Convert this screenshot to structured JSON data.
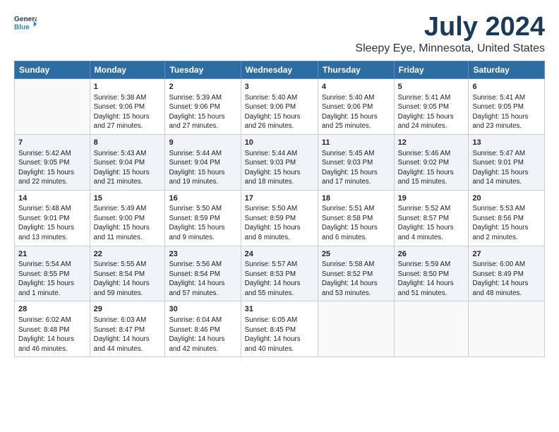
{
  "logo": {
    "line1": "General",
    "line2": "Blue"
  },
  "title": "July 2024",
  "subtitle": "Sleepy Eye, Minnesota, United States",
  "days_of_week": [
    "Sunday",
    "Monday",
    "Tuesday",
    "Wednesday",
    "Thursday",
    "Friday",
    "Saturday"
  ],
  "weeks": [
    [
      {
        "day": "",
        "empty": true
      },
      {
        "day": "1",
        "sunrise": "5:38 AM",
        "sunset": "9:06 PM",
        "daylight": "15 hours and 27 minutes."
      },
      {
        "day": "2",
        "sunrise": "5:39 AM",
        "sunset": "9:06 PM",
        "daylight": "15 hours and 27 minutes."
      },
      {
        "day": "3",
        "sunrise": "5:40 AM",
        "sunset": "9:06 PM",
        "daylight": "15 hours and 26 minutes."
      },
      {
        "day": "4",
        "sunrise": "5:40 AM",
        "sunset": "9:06 PM",
        "daylight": "15 hours and 25 minutes."
      },
      {
        "day": "5",
        "sunrise": "5:41 AM",
        "sunset": "9:05 PM",
        "daylight": "15 hours and 24 minutes."
      },
      {
        "day": "6",
        "sunrise": "5:41 AM",
        "sunset": "9:05 PM",
        "daylight": "15 hours and 23 minutes."
      }
    ],
    [
      {
        "day": "7",
        "sunrise": "5:42 AM",
        "sunset": "9:05 PM",
        "daylight": "15 hours and 22 minutes."
      },
      {
        "day": "8",
        "sunrise": "5:43 AM",
        "sunset": "9:04 PM",
        "daylight": "15 hours and 21 minutes."
      },
      {
        "day": "9",
        "sunrise": "5:44 AM",
        "sunset": "9:04 PM",
        "daylight": "15 hours and 19 minutes."
      },
      {
        "day": "10",
        "sunrise": "5:44 AM",
        "sunset": "9:03 PM",
        "daylight": "15 hours and 18 minutes."
      },
      {
        "day": "11",
        "sunrise": "5:45 AM",
        "sunset": "9:03 PM",
        "daylight": "15 hours and 17 minutes."
      },
      {
        "day": "12",
        "sunrise": "5:46 AM",
        "sunset": "9:02 PM",
        "daylight": "15 hours and 15 minutes."
      },
      {
        "day": "13",
        "sunrise": "5:47 AM",
        "sunset": "9:01 PM",
        "daylight": "15 hours and 14 minutes."
      }
    ],
    [
      {
        "day": "14",
        "sunrise": "5:48 AM",
        "sunset": "9:01 PM",
        "daylight": "15 hours and 13 minutes."
      },
      {
        "day": "15",
        "sunrise": "5:49 AM",
        "sunset": "9:00 PM",
        "daylight": "15 hours and 11 minutes."
      },
      {
        "day": "16",
        "sunrise": "5:50 AM",
        "sunset": "8:59 PM",
        "daylight": "15 hours and 9 minutes."
      },
      {
        "day": "17",
        "sunrise": "5:50 AM",
        "sunset": "8:59 PM",
        "daylight": "15 hours and 8 minutes."
      },
      {
        "day": "18",
        "sunrise": "5:51 AM",
        "sunset": "8:58 PM",
        "daylight": "15 hours and 6 minutes."
      },
      {
        "day": "19",
        "sunrise": "5:52 AM",
        "sunset": "8:57 PM",
        "daylight": "15 hours and 4 minutes."
      },
      {
        "day": "20",
        "sunrise": "5:53 AM",
        "sunset": "8:56 PM",
        "daylight": "15 hours and 2 minutes."
      }
    ],
    [
      {
        "day": "21",
        "sunrise": "5:54 AM",
        "sunset": "8:55 PM",
        "daylight": "15 hours and 1 minute."
      },
      {
        "day": "22",
        "sunrise": "5:55 AM",
        "sunset": "8:54 PM",
        "daylight": "14 hours and 59 minutes."
      },
      {
        "day": "23",
        "sunrise": "5:56 AM",
        "sunset": "8:54 PM",
        "daylight": "14 hours and 57 minutes."
      },
      {
        "day": "24",
        "sunrise": "5:57 AM",
        "sunset": "8:53 PM",
        "daylight": "14 hours and 55 minutes."
      },
      {
        "day": "25",
        "sunrise": "5:58 AM",
        "sunset": "8:52 PM",
        "daylight": "14 hours and 53 minutes."
      },
      {
        "day": "26",
        "sunrise": "5:59 AM",
        "sunset": "8:50 PM",
        "daylight": "14 hours and 51 minutes."
      },
      {
        "day": "27",
        "sunrise": "6:00 AM",
        "sunset": "8:49 PM",
        "daylight": "14 hours and 48 minutes."
      }
    ],
    [
      {
        "day": "28",
        "sunrise": "6:02 AM",
        "sunset": "8:48 PM",
        "daylight": "14 hours and 46 minutes."
      },
      {
        "day": "29",
        "sunrise": "6:03 AM",
        "sunset": "8:47 PM",
        "daylight": "14 hours and 44 minutes."
      },
      {
        "day": "30",
        "sunrise": "6:04 AM",
        "sunset": "8:46 PM",
        "daylight": "14 hours and 42 minutes."
      },
      {
        "day": "31",
        "sunrise": "6:05 AM",
        "sunset": "8:45 PM",
        "daylight": "14 hours and 40 minutes."
      },
      {
        "day": "",
        "empty": true
      },
      {
        "day": "",
        "empty": true
      },
      {
        "day": "",
        "empty": true
      }
    ]
  ]
}
